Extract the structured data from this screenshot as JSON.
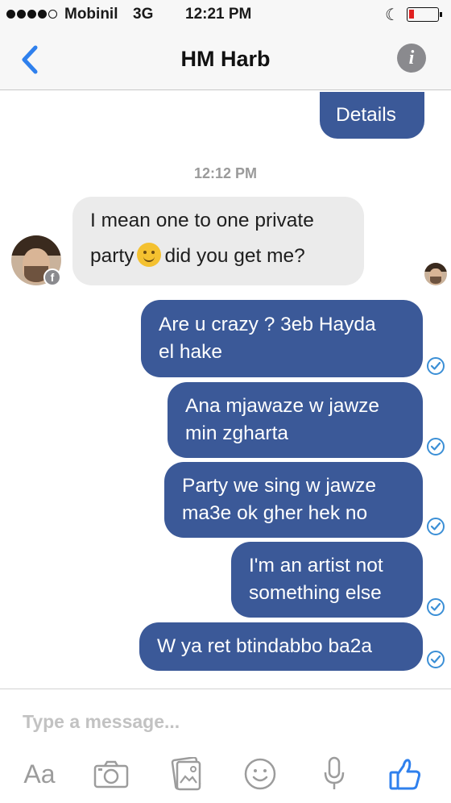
{
  "status_bar": {
    "carrier": "Mobinil",
    "network": "3G",
    "time": "12:21 PM"
  },
  "nav": {
    "title": "HM Harb",
    "back_icon": "chevron-left-icon",
    "info_icon": "info-icon",
    "info_glyph": "i"
  },
  "messages": {
    "details": "Details",
    "timestamp": "12:12 PM",
    "received": {
      "line1": "I mean one to one private",
      "line2_before": "party",
      "line2_after": "did you get me?"
    },
    "sent": [
      {
        "line1": "Are u crazy ? 3eb Hayda",
        "line2": "el hake"
      },
      {
        "line1": "Ana mjawaze w jawze",
        "line2": "min zgharta"
      },
      {
        "line1": "Party we sing w jawze",
        "line2": "ma3e ok gher hek no"
      },
      {
        "line1": "I'm an artist not",
        "line2": "something else"
      },
      {
        "line1": "W ya ret btindabbo ba2a"
      }
    ]
  },
  "composer": {
    "placeholder": "Type a message...",
    "aa_label": "Aa"
  },
  "colors": {
    "outgoing_bubble": "#3b5998",
    "incoming_bubble": "#ebebeb",
    "accent": "#2f80ed",
    "check": "#3b8fd6"
  }
}
